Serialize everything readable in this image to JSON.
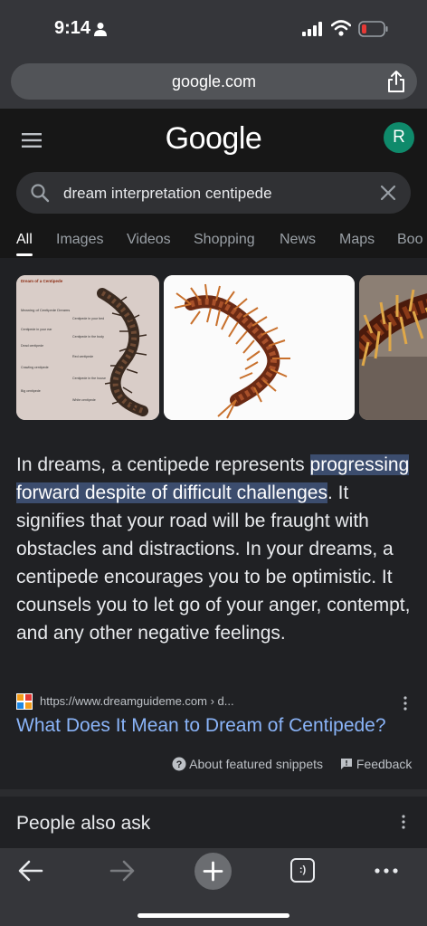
{
  "status_bar": {
    "time": "9:14"
  },
  "browser": {
    "url": "google.com"
  },
  "header": {
    "logo": "Google",
    "avatar_letter": "R"
  },
  "search": {
    "query": "dream interpretation centipede"
  },
  "tabs": [
    "All",
    "Images",
    "Videos",
    "Shopping",
    "News",
    "Maps",
    "Boo"
  ],
  "thumbnail_1": {
    "title": "Dream of a Centipede",
    "lines": [
      "Meaning of Centipede Dreams",
      "Centipede in your ear",
      "Dead centipede",
      "Crawling centipede",
      "Big centipede",
      "Centipede in your bed",
      "Centipede in the body",
      "Red centipede",
      "Centipede in the house",
      "White centipede"
    ]
  },
  "snippet": {
    "intro": "In dreams, a centipede represents ",
    "highlight": "progressing forward despite of difficult challenges",
    "rest": ". It signifies that your road will be fraught with obstacles and distractions. In your dreams, a centipede encourages you to be optimistic. It counsels you to let go of your anger, contempt, and any other negative feelings."
  },
  "result": {
    "source_url": "https://www.dreamguideme.com › d...",
    "title": "What Does It Mean to Dream of Centipede?"
  },
  "meta": {
    "about": "About featured snippets",
    "feedback": "Feedback"
  },
  "people_also_ask": "People also ask",
  "toolbar": {
    "tabs_count": ":)"
  },
  "colors": {
    "link": "#8ab4f8",
    "highlight": "#3c4d6e",
    "avatar": "#0f8a6b"
  }
}
